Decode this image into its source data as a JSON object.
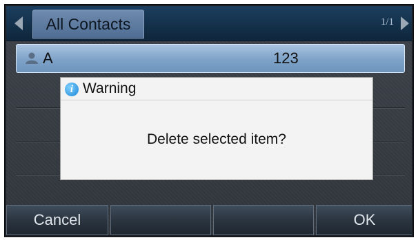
{
  "header": {
    "tab_label": "All Contacts",
    "page_indicator": "1/1",
    "prev_icon": "left-arrow-icon",
    "next_icon": "right-arrow-icon"
  },
  "contacts": [
    {
      "name": "A",
      "number": "123",
      "icon": "person-icon",
      "selected": true
    }
  ],
  "dialog": {
    "title": "Warning",
    "icon": "info-icon",
    "message": "Delete selected item?"
  },
  "softkeys": [
    "Cancel",
    "",
    "",
    "OK"
  ],
  "colors": {
    "title_bar": "#133049",
    "selected_row": "#7ea2c8",
    "dialog_bg": "#f3f3f3",
    "info_icon": "#1c87d6"
  }
}
